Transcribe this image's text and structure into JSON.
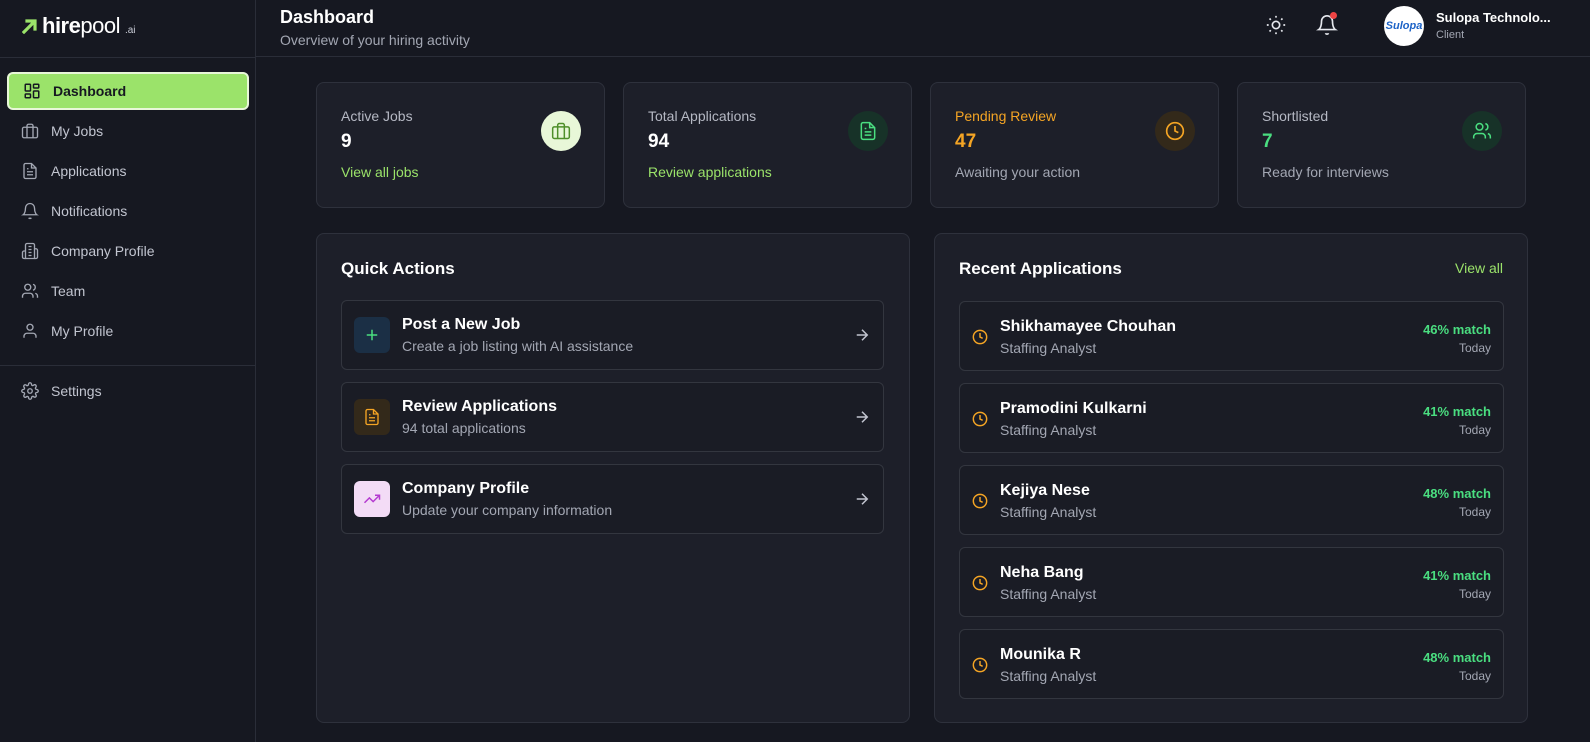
{
  "brand": {
    "name_bold": "hire",
    "name_light": "pool",
    "suffix": ".ai"
  },
  "sidebar": {
    "items": [
      {
        "label": "Dashboard",
        "icon": "dashboard-icon"
      },
      {
        "label": "My Jobs",
        "icon": "briefcase-icon"
      },
      {
        "label": "Applications",
        "icon": "document-icon"
      },
      {
        "label": "Notifications",
        "icon": "bell-icon"
      },
      {
        "label": "Company Profile",
        "icon": "building-icon"
      },
      {
        "label": "Team",
        "icon": "users-icon"
      },
      {
        "label": "My Profile",
        "icon": "user-icon"
      }
    ],
    "settings_label": "Settings"
  },
  "header": {
    "title": "Dashboard",
    "subtitle": "Overview of your hiring activity",
    "user_name": "Sulopa Technolo...",
    "user_role": "Client",
    "avatar_text": "Sulopa"
  },
  "stats": [
    {
      "label": "Active Jobs",
      "value": "9",
      "footer": "View all jobs",
      "footer_is_link": true,
      "value_color": "#ffffff",
      "icon": "briefcase-icon"
    },
    {
      "label": "Total Applications",
      "value": "94",
      "footer": "Review applications",
      "footer_is_link": true,
      "value_color": "#ffffff",
      "icon": "document-icon"
    },
    {
      "label": "Pending Review",
      "value": "47",
      "footer": "Awaiting your action",
      "footer_is_link": false,
      "value_color": "#f5a524",
      "icon": "clock-icon"
    },
    {
      "label": "Shortlisted",
      "value": "7",
      "footer": "Ready for interviews",
      "footer_is_link": false,
      "value_color": "#4ade80",
      "icon": "users-icon"
    }
  ],
  "quick_actions": {
    "title": "Quick Actions",
    "items": [
      {
        "title": "Post a New Job",
        "subtitle": "Create a job listing with AI assistance",
        "icon": "plus-icon"
      },
      {
        "title": "Review Applications",
        "subtitle": "94 total applications",
        "icon": "document-icon"
      },
      {
        "title": "Company Profile",
        "subtitle": "Update your company information",
        "icon": "trending-up-icon"
      }
    ]
  },
  "recent_applications": {
    "title": "Recent Applications",
    "view_all": "View all",
    "items": [
      {
        "name": "Shikhamayee Chouhan",
        "role": "Staffing Analyst",
        "match": "46% match",
        "date": "Today"
      },
      {
        "name": "Pramodini Kulkarni",
        "role": "Staffing Analyst",
        "match": "41% match",
        "date": "Today"
      },
      {
        "name": "Kejiya Nese",
        "role": "Staffing Analyst",
        "match": "48% match",
        "date": "Today"
      },
      {
        "name": "Neha Bang",
        "role": "Staffing Analyst",
        "match": "41% match",
        "date": "Today"
      },
      {
        "name": "Mounika R",
        "role": "Staffing Analyst",
        "match": "48% match",
        "date": "Today"
      }
    ]
  },
  "colors": {
    "accent": "#9be36a",
    "background": "#161821",
    "card": "#1d1f29",
    "warning": "#f5a524",
    "success": "#4ade80"
  }
}
